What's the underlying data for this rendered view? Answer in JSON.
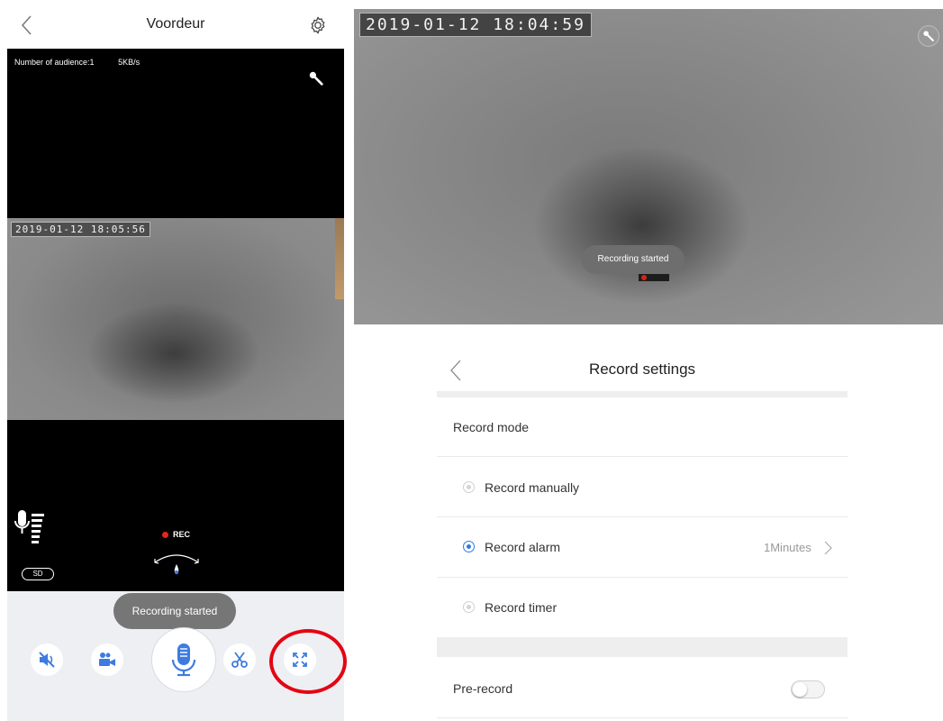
{
  "live_view": {
    "header_title": "Voordeur",
    "audience_label": "Number of audience:1",
    "bitrate": "5KB/s",
    "timestamp": "2019-01-12  18:05:56",
    "sd_badge": "SD",
    "rec_label": "REC",
    "toast": "Recording started",
    "controls": {
      "items": [
        "mute-icon",
        "camcorder-icon",
        "microphone-icon",
        "scissors-icon",
        "fullscreen-icon"
      ],
      "accent_color": "#3d7be0"
    },
    "highlight_color": "#e30613"
  },
  "fullscreen_view": {
    "timestamp": "2019-01-12  18:04:59",
    "toast": "Recording started"
  },
  "record_settings": {
    "title": "Record settings",
    "section_label": "Record mode",
    "options": [
      {
        "label": "Record manually",
        "selected": false
      },
      {
        "label": "Record alarm",
        "selected": true,
        "value": "1Minutes"
      },
      {
        "label": "Record timer",
        "selected": false
      }
    ],
    "pre_record": {
      "label": "Pre-record",
      "enabled": false
    },
    "accent_color": "#2d7be5"
  }
}
